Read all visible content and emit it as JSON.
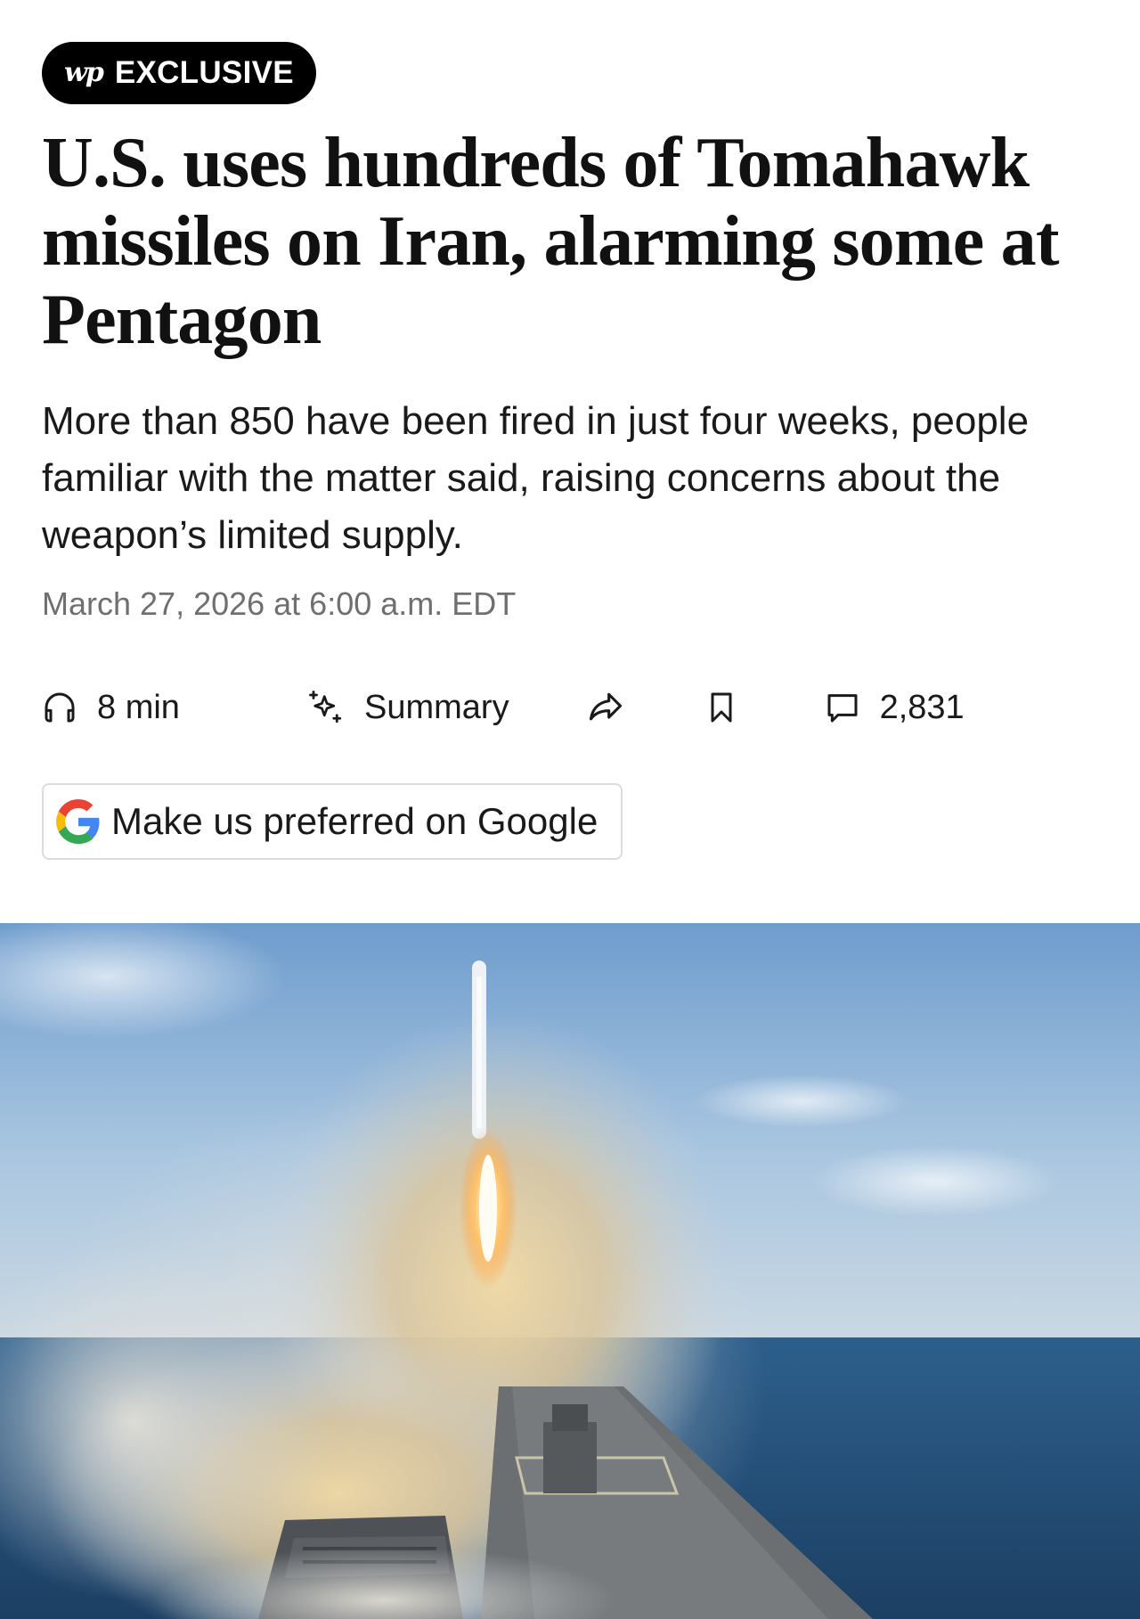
{
  "badge": {
    "logo": "wp",
    "label": "EXCLUSIVE"
  },
  "article": {
    "headline": "U.S. uses hundreds of Tomahawk missiles on Iran, alarming some at Pentagon",
    "dek": "More than 850 have been fired in just four weeks, people familiar with the matter said, raising concerns about the weapon’s limited supply.",
    "dateline": "March 27, 2026 at 6:00 a.m. EDT"
  },
  "toolbar": {
    "listen_label": "8 min",
    "summary_label": "Summary",
    "comments_count": "2,831",
    "icons": [
      "headphones-icon",
      "sparkle-icon",
      "share-icon",
      "bookmark-icon",
      "comment-icon"
    ]
  },
  "google_button": {
    "label": "Make us preferred on Google"
  },
  "colors": {
    "badge_bg": "#000000",
    "text": "#111111",
    "muted": "#6f6f6f",
    "border": "#dcdcdc",
    "google_blue": "#4285F4",
    "google_red": "#EA4335",
    "google_yellow": "#FBBC05",
    "google_green": "#34A853"
  }
}
